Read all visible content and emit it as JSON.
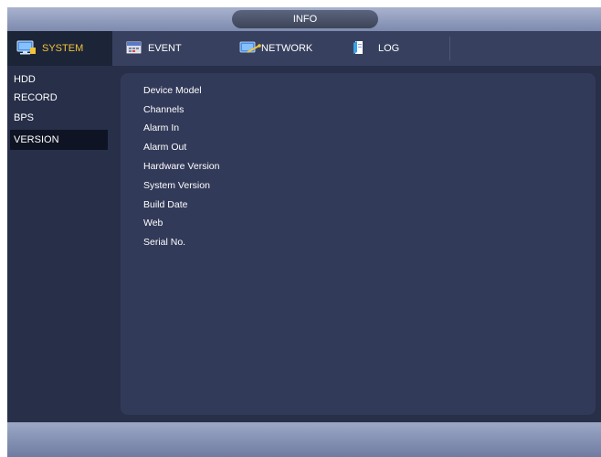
{
  "window": {
    "title": "INFO"
  },
  "tabs": [
    {
      "label": "SYSTEM",
      "icon": "system-icon",
      "active": true
    },
    {
      "label": "EVENT",
      "icon": "event-icon",
      "active": false
    },
    {
      "label": "NETWORK",
      "icon": "network-icon",
      "active": false
    },
    {
      "label": "LOG",
      "icon": "log-icon",
      "active": false
    }
  ],
  "sidebar": {
    "items": [
      {
        "label": "HDD",
        "active": false
      },
      {
        "label": "RECORD",
        "active": false
      },
      {
        "label": "BPS",
        "active": false
      },
      {
        "label": "VERSION",
        "active": true
      }
    ]
  },
  "version_info": {
    "fields": [
      {
        "label": "Device Model"
      },
      {
        "label": "Channels"
      },
      {
        "label": "Alarm In"
      },
      {
        "label": "Alarm Out"
      },
      {
        "label": "Hardware Version"
      },
      {
        "label": "System Version"
      },
      {
        "label": "Build Date"
      },
      {
        "label": "Web"
      },
      {
        "label": "Serial No."
      }
    ]
  },
  "colors": {
    "accent": "#f1c43a",
    "panel": "#323a59",
    "background": "#272f49",
    "tabbar": "#37415f"
  }
}
